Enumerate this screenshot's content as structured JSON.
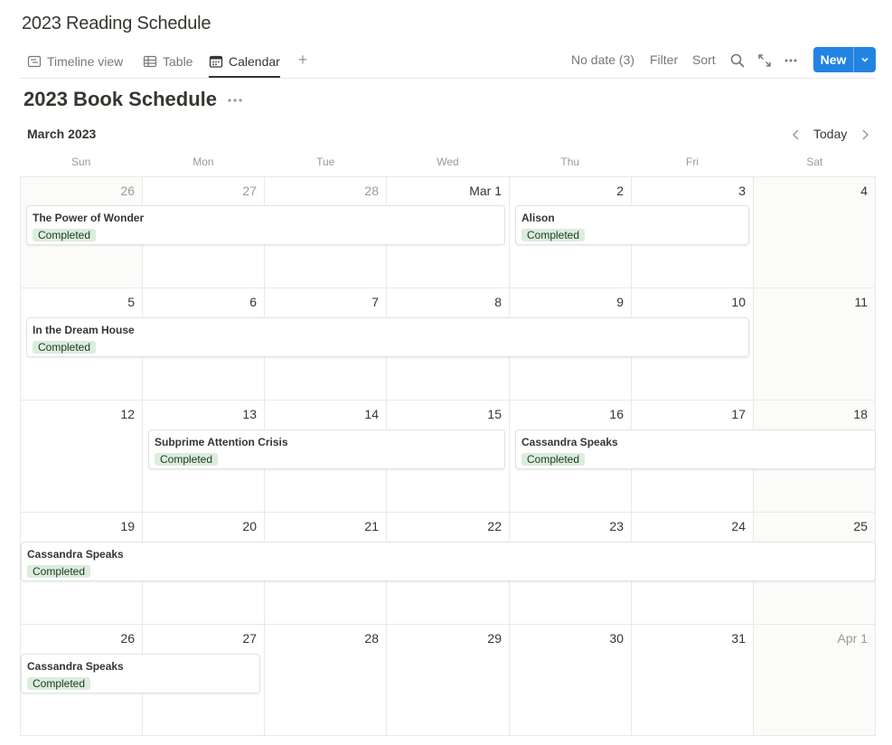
{
  "page": {
    "title": "2023 Reading Schedule"
  },
  "views": {
    "tabs": [
      {
        "label": "Timeline view",
        "icon": "timeline-icon",
        "active": false
      },
      {
        "label": "Table",
        "icon": "table-icon",
        "active": false
      },
      {
        "label": "Calendar",
        "icon": "calendar-icon",
        "active": true
      }
    ],
    "add_icon": "plus-icon"
  },
  "toolbar": {
    "no_date": "No date (3)",
    "filter": "Filter",
    "sort": "Sort",
    "new_label": "New",
    "accent": "#2383e2"
  },
  "database": {
    "title": "2023 Book Schedule"
  },
  "calendar": {
    "month": "March 2023",
    "today_label": "Today",
    "weekdays": [
      "Sun",
      "Mon",
      "Tue",
      "Wed",
      "Thu",
      "Fri",
      "Sat"
    ],
    "weeks": [
      [
        "26",
        "27",
        "28",
        "Mar 1",
        "2",
        "3",
        "4"
      ],
      [
        "5",
        "6",
        "7",
        "8",
        "9",
        "10",
        "11"
      ],
      [
        "12",
        "13",
        "14",
        "15",
        "16",
        "17",
        "18"
      ],
      [
        "19",
        "20",
        "21",
        "22",
        "23",
        "24",
        "25"
      ],
      [
        "26",
        "27",
        "28",
        "29",
        "30",
        "31",
        "Apr 1"
      ]
    ],
    "events": [
      {
        "title": "The Power of Wonder",
        "status": "Completed"
      },
      {
        "title": "Alison",
        "status": "Completed"
      },
      {
        "title": "In the Dream House",
        "status": "Completed"
      },
      {
        "title": "Subprime Attention Crisis",
        "status": "Completed"
      },
      {
        "title": "Cassandra Speaks",
        "status": "Completed"
      },
      {
        "title": "Cassandra Speaks",
        "status": "Completed"
      },
      {
        "title": "Cassandra Speaks",
        "status": "Completed"
      }
    ],
    "status_color": "#dbeddb"
  }
}
